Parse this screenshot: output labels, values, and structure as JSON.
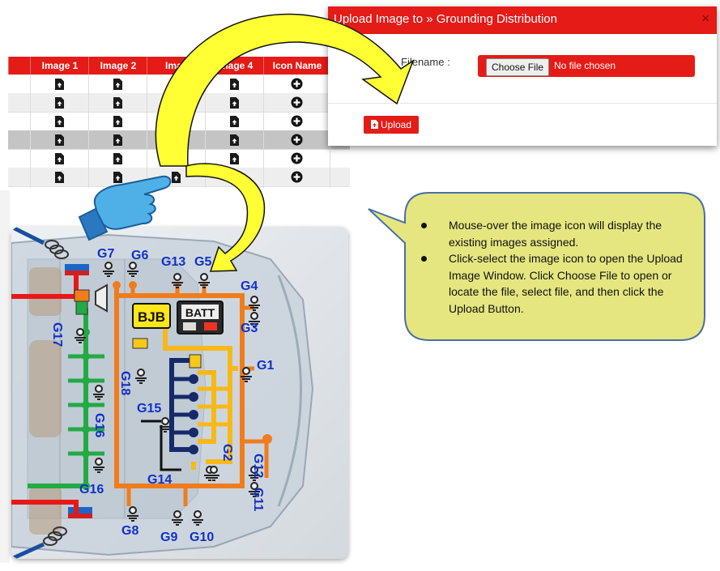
{
  "table": {
    "headers": [
      "Image 1",
      "Image 2",
      "Imag",
      "Image 4",
      "Icon Name"
    ],
    "row_count": 6
  },
  "modal": {
    "title": "Upload Image to » Grounding Distribution",
    "close_glyph": "×",
    "filename_label": "Filename :",
    "choose_file_label": "Choose File",
    "no_file_text": "No file chosen",
    "upload_label": "Upload"
  },
  "callout": {
    "bullets": [
      "Mouse-over the image icon will display the existing images assigned.",
      "Click-select the image icon to open the Upload Image Window. Click Choose File to open or locate the file, select file, and then click the Upload Button."
    ]
  },
  "diagram": {
    "boxes": {
      "bjb": "BJB",
      "batt": "BATT",
      "batt_terminals": "- +"
    },
    "ground_labels": {
      "g1": "G1",
      "g2": "G2",
      "g3": "G3",
      "g4": "G4",
      "g5": "G5",
      "g6": "G6",
      "g7": "G7",
      "g8": "G8",
      "g9": "G9",
      "g10": "G10",
      "g11": "G11",
      "g12": "G12",
      "g13": "G13",
      "g14": "G14",
      "g15": "G15",
      "g16a": "G16",
      "g16b": "G16",
      "g17": "G17",
      "g18": "G18"
    }
  },
  "icons": {
    "file_upload": "file-upload-icon",
    "add": "plus-circle-icon",
    "pointer": "pointing-hand-icon",
    "arrow": "curved-arrow"
  },
  "colors": {
    "brand_red": "#e41b17",
    "callout_fill": "#e6e680",
    "callout_border": "#4a6fa5",
    "arrow_fill": "#ffff33",
    "wire_orange": "#f07c1c",
    "wire_yellow": "#f8b818",
    "wire_green": "#22aa44",
    "wire_navy": "#162a6a",
    "wire_red": "#e81818"
  }
}
